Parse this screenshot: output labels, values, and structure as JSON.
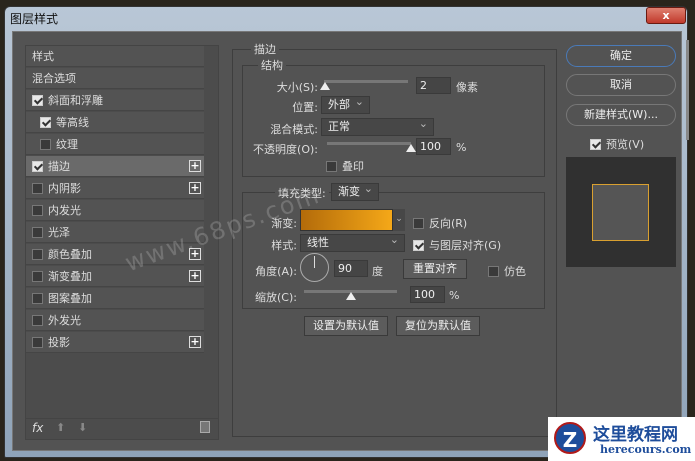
{
  "window": {
    "title": "图层样式",
    "close": "x"
  },
  "styles": [
    {
      "label": "样式",
      "checkbox": null,
      "plus": false
    },
    {
      "label": "混合选项",
      "checkbox": null,
      "plus": false
    },
    {
      "label": "斜面和浮雕",
      "checkbox": true,
      "plus": false
    },
    {
      "label": "等高线",
      "checkbox": true,
      "plus": false,
      "indent": true
    },
    {
      "label": "纹理",
      "checkbox": false,
      "plus": false,
      "indent": true
    },
    {
      "label": "描边",
      "checkbox": true,
      "plus": true,
      "selected": true
    },
    {
      "label": "内阴影",
      "checkbox": false,
      "plus": true
    },
    {
      "label": "内发光",
      "checkbox": false,
      "plus": false
    },
    {
      "label": "光泽",
      "checkbox": false,
      "plus": false
    },
    {
      "label": "颜色叠加",
      "checkbox": false,
      "plus": true
    },
    {
      "label": "渐变叠加",
      "checkbox": false,
      "plus": true
    },
    {
      "label": "图案叠加",
      "checkbox": false,
      "plus": false
    },
    {
      "label": "外发光",
      "checkbox": false,
      "plus": false
    },
    {
      "label": "投影",
      "checkbox": false,
      "plus": true
    }
  ],
  "footer": {
    "fx": "fx"
  },
  "stroke": {
    "section": "描边",
    "structure": "结构",
    "size_label": "大小(S):",
    "size": "2",
    "size_unit": "像素",
    "size_fraction": 0.01,
    "position_label": "位置:",
    "position": "外部",
    "blend_label": "混合模式:",
    "blend": "正常",
    "opacity_label": "不透明度(O):",
    "opacity": "100",
    "opacity_unit": "%",
    "opacity_fraction": 1.0,
    "overprint": "叠印",
    "fill_type_label": "填充类型:",
    "fill_type": "渐变",
    "gradient_label": "渐变:",
    "reverse": "反向(R)",
    "style_label": "样式:",
    "style": "线性",
    "align": "与图层对齐(G)",
    "angle_label": "角度(A):",
    "angle": "90",
    "angle_unit": "度",
    "reset_align": "重置对齐",
    "dither": "仿色",
    "scale_label": "缩放(C):",
    "scale": "100",
    "scale_unit": "%",
    "scale_fraction": 0.5,
    "make_default": "设置为默认值",
    "reset_default": "复位为默认值"
  },
  "right": {
    "ok": "确定",
    "cancel": "取消",
    "new_style": "新建样式(W)...",
    "preview": "预览(V)"
  },
  "colors": {
    "gradient_start": "#b36b0a",
    "gradient_end": "#f5a818",
    "stroke_preview": "#d9a030"
  },
  "watermark": "www.68ps.com",
  "logo": {
    "title": "这里教程网",
    "url": "herecours.com"
  }
}
